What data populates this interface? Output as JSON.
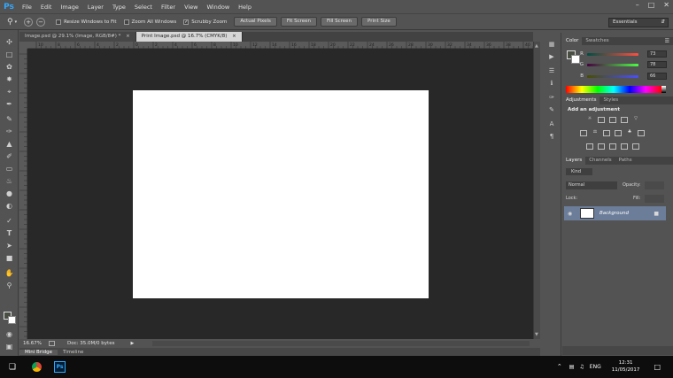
{
  "app": {
    "logo": "Ps"
  },
  "menu": [
    "File",
    "Edit",
    "Image",
    "Layer",
    "Type",
    "Select",
    "Filter",
    "View",
    "Window",
    "Help"
  ],
  "window_controls": {
    "minimize": "–",
    "maximize": "□",
    "close": "✕"
  },
  "options": {
    "resize_windows": "Resize Windows to Fit",
    "zoom_all": "Zoom All Windows",
    "scrubby": "Scrubby Zoom",
    "actual_pixels": "Actual Pixels",
    "fit_screen": "Fit Screen",
    "fill_screen": "Fill Screen",
    "print_size": "Print Size",
    "workspace": "Essentials"
  },
  "tabs": [
    {
      "label": "Image.psd @ 29.1% (Image, RGB/8#) *"
    },
    {
      "label": "Print Image.psd @ 16.7% (CMYK/8)"
    }
  ],
  "ruler_top": [
    "10",
    "8",
    "6",
    "4",
    "2",
    "0",
    "2",
    "4",
    "6",
    "8",
    "10",
    "12",
    "14",
    "16",
    "18",
    "20",
    "22",
    "24",
    "26",
    "28",
    "30",
    "32",
    "34",
    "36",
    "38",
    "40"
  ],
  "status": {
    "zoom": "16.67%",
    "doc": "Doc: 35.0M/0 bytes"
  },
  "bottom_tabs": [
    "Mini Bridge",
    "Timeline"
  ],
  "color_panel": {
    "tabs": [
      "Color",
      "Swatches"
    ],
    "r": {
      "label": "R",
      "value": "73"
    },
    "g": {
      "label": "G",
      "value": "78"
    },
    "b": {
      "label": "B",
      "value": "66"
    }
  },
  "adjustments_panel": {
    "tabs": [
      "Adjustments",
      "Styles"
    ],
    "heading": "Add an adjustment"
  },
  "layers_panel": {
    "tabs": [
      "Layers",
      "Channels",
      "Paths"
    ],
    "kind": "Kind",
    "blend": "Normal",
    "opacity_label": "Opacity:",
    "lock_label": "Lock:",
    "fill_label": "Fill:",
    "layer_name": "Background"
  },
  "taskbar": {
    "lang": "ENG",
    "time": "12:31",
    "date": "11/05/2017"
  }
}
